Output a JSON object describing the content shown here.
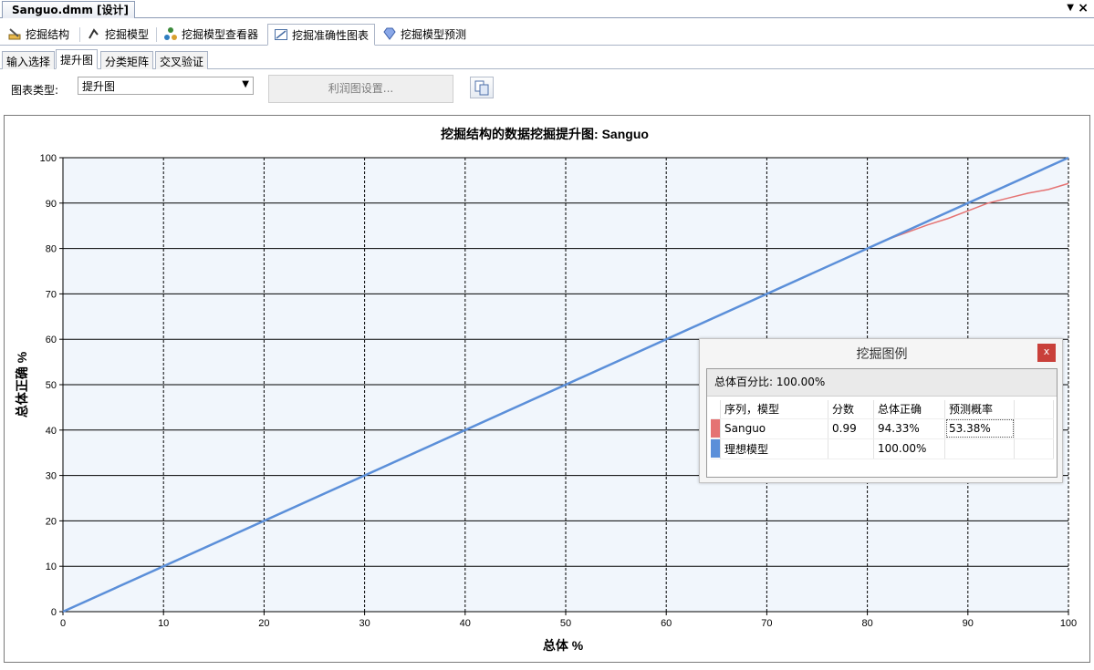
{
  "document_tab": {
    "title": "Sanguo.dmm [设计]"
  },
  "designer_tabs": [
    {
      "label": "挖掘结构",
      "icon": "mining-structure-icon"
    },
    {
      "label": "挖掘模型",
      "icon": "mining-model-icon"
    },
    {
      "label": "挖掘模型查看器",
      "icon": "model-viewer-icon"
    },
    {
      "label": "挖掘准确性图表",
      "icon": "accuracy-chart-icon"
    },
    {
      "label": "挖掘模型预测",
      "icon": "prediction-gem-icon"
    }
  ],
  "sub_tabs": [
    "输入选择",
    "提升图",
    "分类矩阵",
    "交叉验证"
  ],
  "toolbar": {
    "chart_type_label": "图表类型:",
    "chart_type_value": "提升图",
    "profit_settings_label": "利润图设置..."
  },
  "legend": {
    "title": "挖掘图例",
    "close_label": "x",
    "summary": "总体百分比: 100.00%",
    "headers": [
      "序列，模型",
      "分数",
      "总体正确",
      "预测概率"
    ],
    "rows": [
      {
        "name": "Sanguo",
        "score": "0.99",
        "correct": "94.33%",
        "probability": "53.38%",
        "color": "#e57373"
      },
      {
        "name": "理想模型",
        "score": "",
        "correct": "100.00%",
        "probability": "",
        "color": "#5b8fd9"
      }
    ]
  },
  "chart_data": {
    "type": "line",
    "title": "挖掘结构的数据挖掘提升图: Sanguo",
    "xlabel": "总体 %",
    "ylabel": "总体正确 %",
    "xlim": [
      0,
      100
    ],
    "ylim": [
      0,
      100
    ],
    "xticks": [
      0,
      10,
      20,
      30,
      40,
      50,
      60,
      70,
      80,
      90,
      100
    ],
    "yticks": [
      0,
      10,
      20,
      30,
      40,
      50,
      60,
      70,
      80,
      90,
      100
    ],
    "grid": true,
    "series": [
      {
        "name": "Sanguo",
        "color": "#e57373",
        "x": [
          0,
          10,
          20,
          30,
          40,
          50,
          60,
          70,
          80,
          82,
          84,
          86,
          88,
          90,
          92,
          94,
          96,
          98,
          100
        ],
        "y": [
          0,
          10,
          20,
          30,
          40,
          50,
          60,
          70,
          80,
          82,
          83.6,
          85.2,
          86.6,
          88.3,
          90.0,
          91.1,
          92.2,
          93.0,
          94.33
        ]
      },
      {
        "name": "理想模型",
        "color": "#5b8fd9",
        "x": [
          0,
          100
        ],
        "y": [
          0,
          100
        ]
      }
    ]
  }
}
